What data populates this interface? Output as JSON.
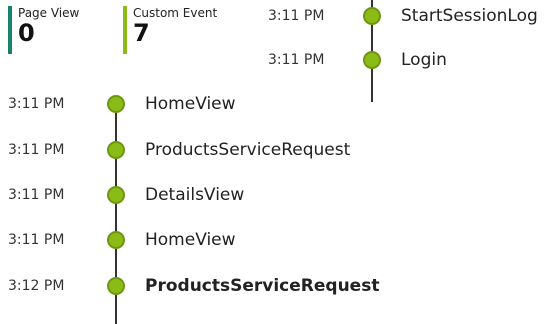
{
  "stats": {
    "page_view": {
      "label": "Page View",
      "value": "0",
      "color": "#1a7f6b"
    },
    "custom_event": {
      "label": "Custom Event",
      "value": "7",
      "color": "#8bbb16"
    }
  },
  "timeline": {
    "dot_color": "#8bbb16",
    "top_events": [
      {
        "time": "3:11 PM",
        "name": "StartSessionLog"
      },
      {
        "time": "3:11 PM",
        "name": "Login"
      }
    ],
    "main_events": [
      {
        "time": "3:11 PM",
        "name": "HomeView"
      },
      {
        "time": "3:11 PM",
        "name": "ProductsServiceRequest"
      },
      {
        "time": "3:11 PM",
        "name": "DetailsView"
      },
      {
        "time": "3:11 PM",
        "name": "HomeView"
      },
      {
        "time": "3:12 PM",
        "name": "ProductsServiceRequest",
        "selected": true
      }
    ]
  }
}
